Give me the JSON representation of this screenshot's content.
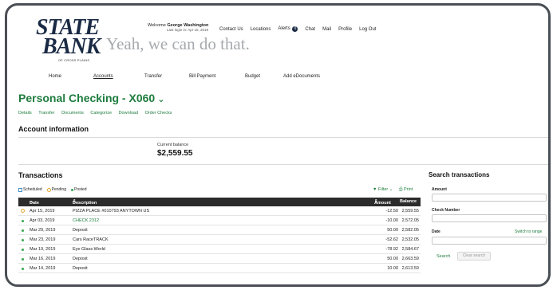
{
  "logo": {
    "line1": "STATE",
    "line2": "BANK",
    "sub": "OF CROSS PLAINS"
  },
  "tagline": "Yeah, we can do that.",
  "welcome": {
    "prefix": "Welcome",
    "name": "George Washington",
    "last_login": "Last login in: Apr 16, 2019"
  },
  "toplinks": {
    "contact": "Contact Us",
    "locations": "Locations",
    "alerts": "Alerts",
    "alerts_count": "0",
    "chat": "Chat",
    "mail": "Mail",
    "profile": "Profile",
    "logout": "Log Out"
  },
  "mainnav": {
    "home": "Home",
    "accounts": "Accounts",
    "transfer": "Transfer",
    "bill_payment": "Bill Payment",
    "budget": "Budget",
    "edocs": "Add eDocuments"
  },
  "page_title": "Personal Checking - X060",
  "subnav": {
    "details": "Details",
    "transfer": "Transfer",
    "documents": "Documents",
    "categorize": "Categorize",
    "download": "Download",
    "order_checks": "Order Checks"
  },
  "account_info": {
    "header": "Account information",
    "balance_label": "Current balance",
    "balance_value": "$2,559.55"
  },
  "transactions": {
    "header": "Transactions",
    "legend": {
      "scheduled": "Scheduled",
      "pending": "Pending",
      "posted": "Posted"
    },
    "filter": "Filter",
    "print": "Print",
    "columns": {
      "date": "Date",
      "description": "Description",
      "amount": "Amount",
      "balance": "Balance"
    },
    "rows": [
      {
        "date": "Apr 15, 2019",
        "description": "PIZZA PLACE #010793 ANYTOWN US",
        "amount": "-12.50",
        "balance": "2,559.55"
      },
      {
        "date": "Apr 03, 2019",
        "description": "CHECK 2312",
        "amount": "-10.00",
        "balance": "2,572.05"
      },
      {
        "date": "Mar 29, 2019",
        "description": "Deposit",
        "amount": "50.00",
        "balance": "2,582.05"
      },
      {
        "date": "Mar 23, 2019",
        "description": "Cars RaceTRACK",
        "amount": "-52.62",
        "balance": "2,532.05"
      },
      {
        "date": "Mar 19, 2019",
        "description": "Eye Glass World",
        "amount": "-78.92",
        "balance": "2,584.67"
      },
      {
        "date": "Mar 16, 2019",
        "description": "Deposit",
        "amount": "50.00",
        "balance": "2,663.59"
      },
      {
        "date": "Mar 14, 2019",
        "description": "Deposit",
        "amount": "10.00",
        "balance": "2,613.59"
      }
    ]
  },
  "search": {
    "header": "Search transactions",
    "amount_label": "Amount",
    "check_label": "Check Number",
    "date_label": "Date",
    "range_link": "Switch to range",
    "search_btn": "Search",
    "clear_btn": "Clear search"
  },
  "colors": {
    "brand_green": "#1e7c3e",
    "navy": "#1a2a44",
    "table_header": "#2b2b2b",
    "posted": "#36a84f",
    "pending": "#e1a52b"
  }
}
